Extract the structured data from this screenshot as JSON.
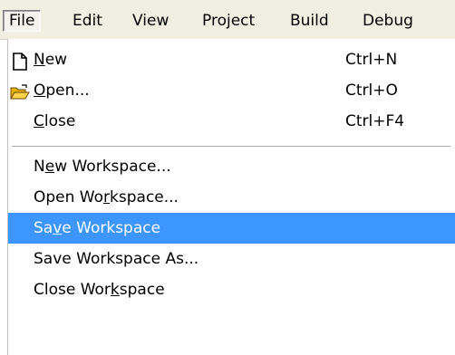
{
  "menubar": {
    "items": [
      {
        "label": "File",
        "active": true
      },
      {
        "label": "Edit"
      },
      {
        "label": "View"
      },
      {
        "label": "Project"
      },
      {
        "label": "Build"
      },
      {
        "label": "Debug"
      }
    ]
  },
  "dropdown": {
    "items": [
      {
        "label_before": "",
        "label_mnemonic": "N",
        "label_after": "ew",
        "shortcut": "Ctrl+N",
        "icon": "new-file-icon"
      },
      {
        "label_before": "",
        "label_mnemonic": "O",
        "label_after": "pen...",
        "shortcut": "Ctrl+O",
        "icon": "open-folder-icon"
      },
      {
        "label_before": "",
        "label_mnemonic": "C",
        "label_after": "lose",
        "shortcut": "Ctrl+F4"
      },
      {
        "label_before": "N",
        "label_mnemonic": "e",
        "label_after": "w Workspace..."
      },
      {
        "label_before": "Open Wo",
        "label_mnemonic": "r",
        "label_after": "kspace..."
      },
      {
        "label_before": "Sa",
        "label_mnemonic": "v",
        "label_after": "e Workspace",
        "selected": true
      },
      {
        "label_before": "Save Workspace As...",
        "label_mnemonic": "",
        "label_after": ""
      },
      {
        "label_before": "Close Wor",
        "label_mnemonic": "k",
        "label_after": "space"
      }
    ]
  },
  "colors": {
    "menubar_bg": "#f1efe2",
    "selection_bg": "#3d95ff",
    "selection_text": "#ffffff"
  }
}
